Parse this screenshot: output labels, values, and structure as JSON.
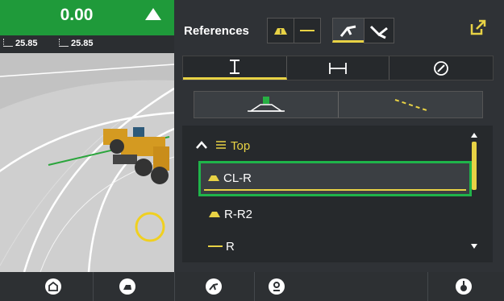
{
  "status": {
    "value": "0.00",
    "left_offset": "25.85",
    "right_offset": "25.85",
    "accent": "#1f9a3a"
  },
  "references": {
    "title": "References",
    "icons": [
      "road-surface-icon",
      "line-icon",
      "slope-icon",
      "crossfall-icon",
      "open-external-icon"
    ],
    "tabs": [
      {
        "icon": "vertical-measure-icon",
        "selected": true
      },
      {
        "icon": "horizontal-measure-icon",
        "selected": false
      },
      {
        "icon": "compass-icon",
        "selected": false
      }
    ],
    "subtabs": [
      "surface-offset-icon",
      "dashed-line-icon"
    ],
    "group_label": "Top",
    "items": [
      {
        "label": "CL-R",
        "icon": "road-surface-icon",
        "selected": true
      },
      {
        "label": "R-R2",
        "icon": "road-surface-icon",
        "selected": false
      },
      {
        "label": "R",
        "icon": "line-icon",
        "selected": false
      }
    ],
    "highlight": "#e8d245",
    "selected_border": "#1fb44a"
  },
  "bottom_nav": [
    "home-icon",
    "machine-view-icon",
    "slope-icon",
    "location-pin-icon",
    "person-icon"
  ]
}
